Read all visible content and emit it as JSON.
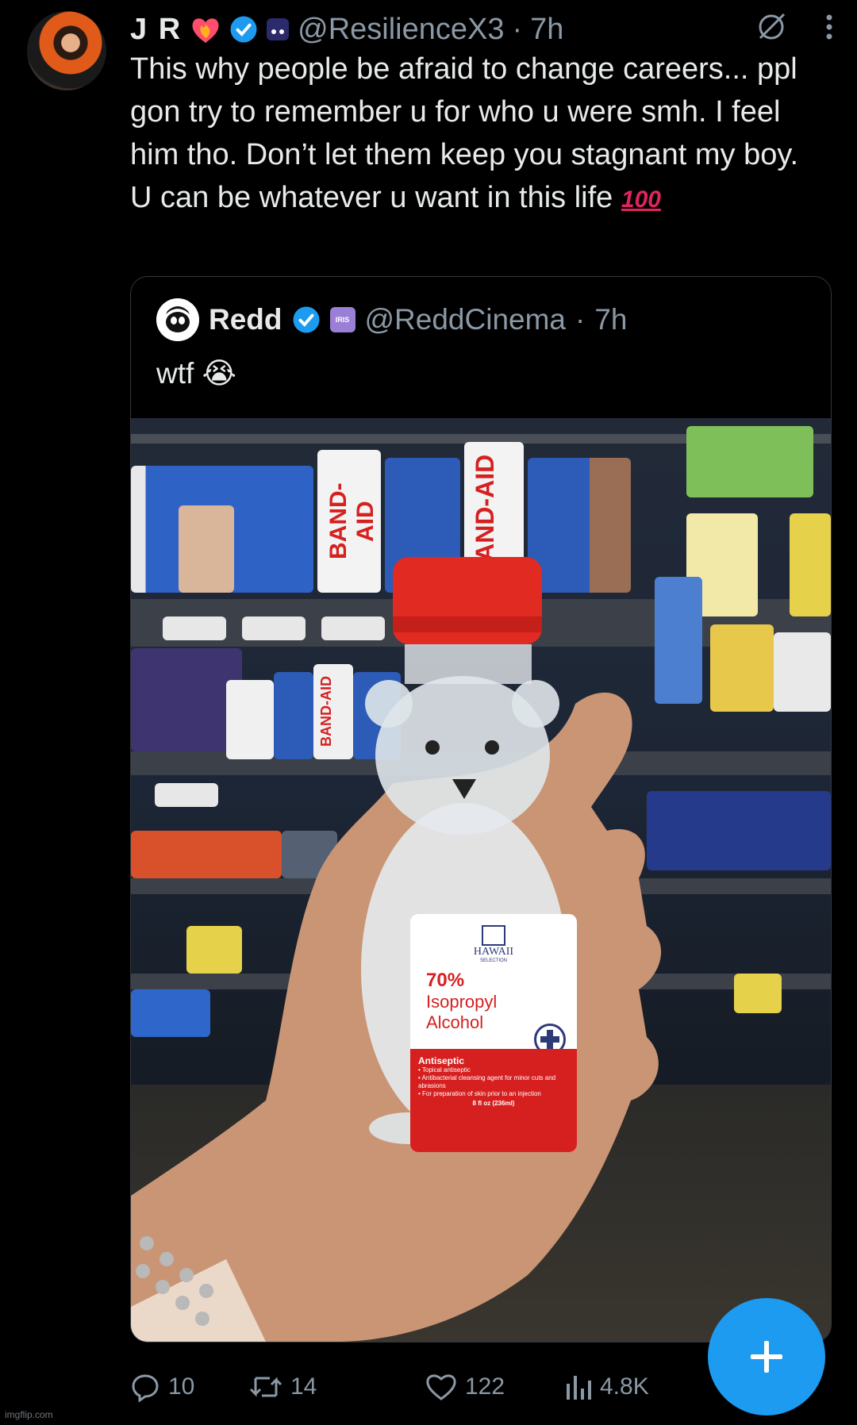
{
  "tweet": {
    "author_name": "J R",
    "handle": "@ResilienceX3",
    "separator": "·",
    "time": "7h",
    "text": "This why people be afraid to change careers... ppl  gon try to remember u for who u were smh. I feel him tho. Don’t let them keep you stagnant my boy. U can be whatever u want in this life",
    "emoji_100": "100"
  },
  "quote": {
    "author_name": "Redd",
    "badge": "IRIS",
    "handle": "@ReddCinema",
    "separator": "·",
    "time": "7h",
    "text": "wtf",
    "emoji": "😭"
  },
  "photo": {
    "shelf_labels": [
      "BAND-AID",
      "BAND-AID",
      "BAND-AID"
    ],
    "label_brand": "HAWAII",
    "label_sub": "SELECTION",
    "label_percent": "70%",
    "label_line1": "Isopropyl",
    "label_line2": "Alcohol",
    "label_antiseptic": "Antiseptic",
    "label_b1": "• Topical antiseptic",
    "label_b2": "• Antibacterial cleansing agent for minor cuts and abrasions",
    "label_b3": "• For preparation of skin prior to an injection",
    "label_size": "8 fl oz (236ml)"
  },
  "actions": {
    "replies": "10",
    "reposts": "14",
    "likes": "122",
    "views": "4.8K"
  },
  "watermark": "imgflip.com",
  "colors": {
    "accent": "#1d9bf0",
    "muted": "#8b98a5",
    "text": "#e7e9ea",
    "like": "#e0245e"
  }
}
